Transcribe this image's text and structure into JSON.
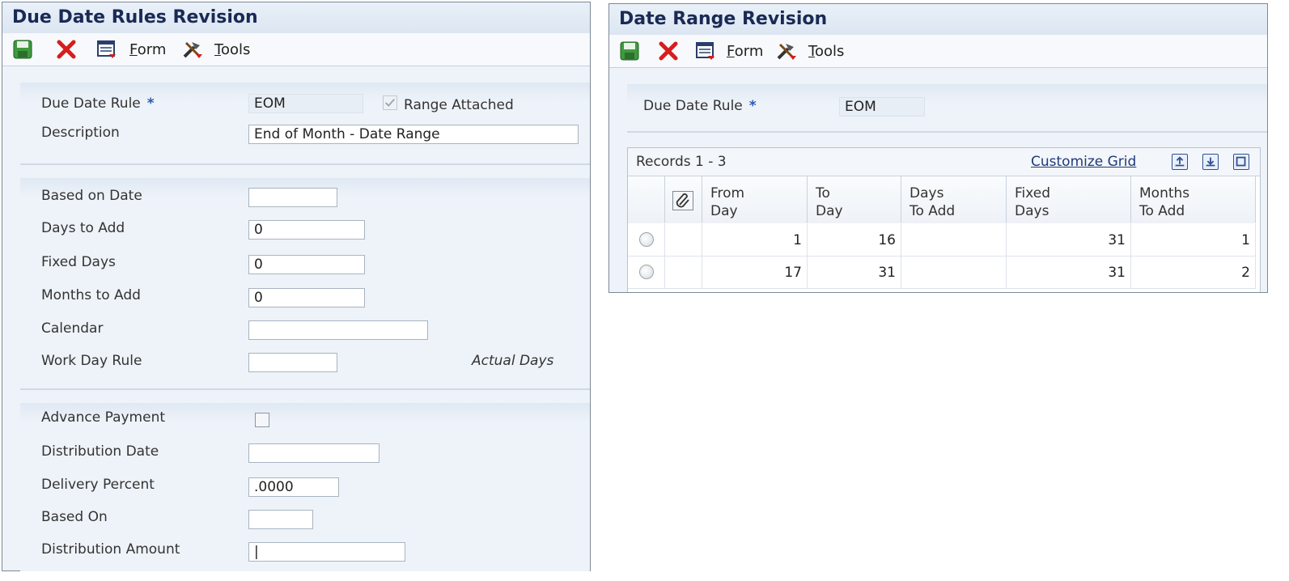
{
  "left": {
    "title": "Due Date Rules Revision",
    "toolbar": {
      "form": "Form",
      "tools": "Tools"
    },
    "fields": {
      "due_date_rule_label": "Due Date Rule",
      "due_date_rule_required": "*",
      "due_date_rule_value": "EOM",
      "range_attached_label": "Range Attached",
      "description_label": "Description",
      "description_value": "End of Month - Date Range",
      "based_on_date_label": "Based on Date",
      "based_on_date_value": "",
      "days_to_add_label": "Days to Add",
      "days_to_add_value": "0",
      "fixed_days_label": "Fixed Days",
      "fixed_days_value": "0",
      "months_to_add_label": "Months to Add",
      "months_to_add_value": "0",
      "calendar_label": "Calendar",
      "calendar_value": "",
      "work_day_rule_label": "Work Day Rule",
      "work_day_rule_value": "",
      "actual_days_text": "Actual Days",
      "advance_payment_label": "Advance Payment",
      "distribution_date_label": "Distribution Date",
      "distribution_date_value": "",
      "delivery_percent_label": "Delivery Percent",
      "delivery_percent_value": ".0000",
      "based_on_label": "Based On",
      "based_on_value": "",
      "distribution_amount_label": "Distribution Amount",
      "distribution_amount_value": "|"
    }
  },
  "right": {
    "title": "Date Range Revision",
    "toolbar": {
      "form": "Form",
      "tools": "Tools"
    },
    "due_date_rule_label": "Due Date Rule",
    "due_date_rule_required": "*",
    "due_date_rule_value": "EOM",
    "grid": {
      "records": "Records 1 - 3",
      "customize": "Customize Grid",
      "columns": [
        {
          "line1": "From",
          "line2": "Day"
        },
        {
          "line1": "To",
          "line2": "Day"
        },
        {
          "line1": "Days",
          "line2": "To Add"
        },
        {
          "line1": "Fixed",
          "line2": "Days"
        },
        {
          "line1": "Months",
          "line2": "To Add"
        }
      ],
      "rows": [
        {
          "from": "1",
          "to": "16",
          "days": "",
          "fixed": "31",
          "months": "1"
        },
        {
          "from": "17",
          "to": "31",
          "days": "",
          "fixed": "31",
          "months": "2"
        }
      ]
    }
  },
  "icons": {
    "save": "save-icon",
    "cancel": "cancel-icon",
    "form": "form-icon",
    "tools": "tools-icon"
  }
}
